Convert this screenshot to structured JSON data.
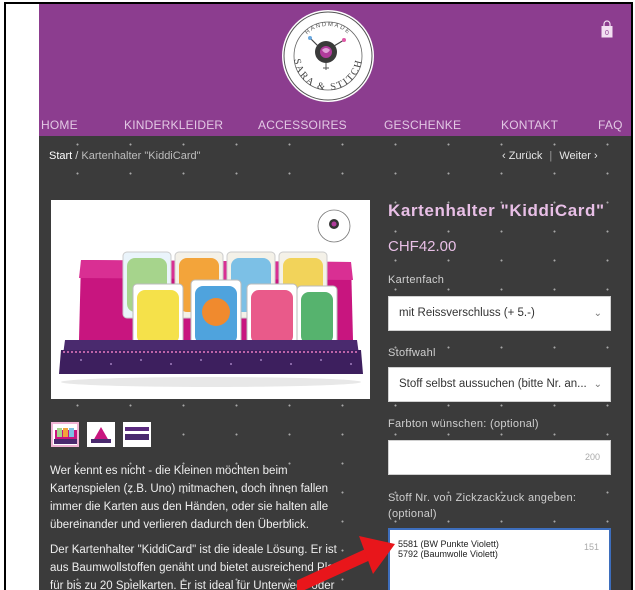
{
  "header": {
    "logo": {
      "top_text": "HANDMADE",
      "bottom_text": "SARA & STITCH"
    },
    "cart_count": "0"
  },
  "nav": {
    "items": [
      {
        "label": "HOME"
      },
      {
        "label": "KINDERKLEIDER"
      },
      {
        "label": "ACCESSOIRES"
      },
      {
        "label": "GESCHENKE"
      },
      {
        "label": "KONTAKT"
      },
      {
        "label": "FAQ"
      }
    ]
  },
  "breadcrumb": {
    "home": "Start",
    "separator": " / ",
    "current": "Kartenhalter \"KiddiCard\""
  },
  "pager": {
    "prev": "‹ Zurück",
    "divider": "|",
    "next": "Weiter ›"
  },
  "product": {
    "title": "Kartenhalter \"KiddiCard\"",
    "price": "CHF42.00",
    "field_compartment": {
      "label": "Kartenfach",
      "value": "mit Reissverschluss (+ 5.-)"
    },
    "field_fabric": {
      "label": "Stoffwahl",
      "value": "Stoff selbst aussuchen (bitte Nr. an..."
    },
    "field_color": {
      "label": "Farbton wünschen: (optional)",
      "value": "",
      "counter": "200"
    },
    "field_fabric_no": {
      "label_line1": "Stoff Nr. von Zickzackzuck angeben:",
      "label_line2": "(optional)",
      "value_line1": "5581 (BW Punkte Violett)",
      "value_line2": "5792 (Baumwolle Violett)",
      "counter": "151"
    }
  },
  "description": {
    "paragraph1": [
      "Wer kennt es nicht - die Kleinen möchten beim",
      "Kartenspielen (z.B. Uno) mitmachen, doch ihnen fallen",
      "immer die Karten aus den Händen, oder sie halten alle",
      "übereinander und verlieren dadurch den Überblick."
    ],
    "paragraph2": [
      "Der Kartenhalter \"KiddiCard\" ist die ideale Lösung. Er ist",
      "aus Baumwollstoffen genäht und bietet ausreichend Platz",
      "für bis zu 20 Spielkarten. Er ist ideal für Unterwegs oder"
    ]
  },
  "colors": {
    "header_purple": "#8c3d8f",
    "page_background": "#3b3b3b",
    "title_pink": "#e8bfe6",
    "annotation_red": "#e8161b",
    "focus_blue": "#3d6ebd"
  }
}
